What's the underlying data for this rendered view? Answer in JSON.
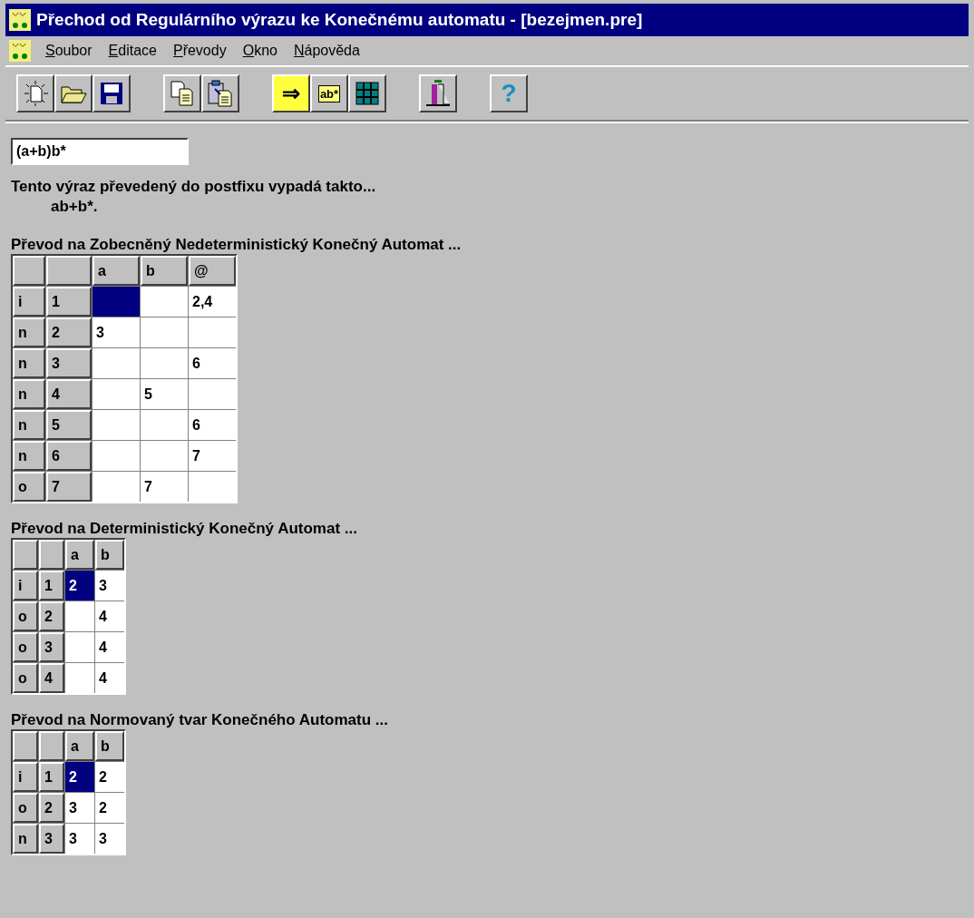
{
  "window": {
    "title": "Přechod od Regulárního výrazu ke Konečnému automatu - [bezejmen.pre]"
  },
  "menu": [
    "Soubor",
    "Editace",
    "Převody",
    "Okno",
    "Nápověda"
  ],
  "toolbar": [
    [
      {
        "kind": "new"
      },
      {
        "kind": "open"
      },
      {
        "kind": "save"
      }
    ],
    [
      {
        "kind": "copy"
      },
      {
        "kind": "paste"
      }
    ],
    [
      {
        "kind": "arrow",
        "label": "⇒",
        "selected": true
      },
      {
        "kind": "text",
        "label": "ab*",
        "selected": false
      },
      {
        "kind": "grid",
        "selected": false
      }
    ],
    [
      {
        "kind": "exit"
      }
    ],
    [
      {
        "kind": "help",
        "label": "?"
      }
    ]
  ],
  "expression": {
    "value": "(a+b)b*"
  },
  "postfix": {
    "caption": "Tento výraz převedený do postfixu vypadá takto...",
    "value": "ab+b*."
  },
  "tables": [
    {
      "title": "Převod na Zobecněný Nedeterministický Konečný Automat ...",
      "columns": [
        "a",
        "b",
        "@"
      ],
      "rows": [
        {
          "type": "i",
          "state": "1",
          "cells": [
            {
              "text": "",
              "selected": true
            },
            {
              "text": "",
              "selected": false
            },
            {
              "text": "2,4",
              "selected": false
            }
          ]
        },
        {
          "type": "n",
          "state": "2",
          "cells": [
            {
              "text": "3",
              "selected": false
            },
            {
              "text": "",
              "selected": false
            },
            {
              "text": "",
              "selected": false
            }
          ]
        },
        {
          "type": "n",
          "state": "3",
          "cells": [
            {
              "text": "",
              "selected": false
            },
            {
              "text": "",
              "selected": false
            },
            {
              "text": "6",
              "selected": false
            }
          ]
        },
        {
          "type": "n",
          "state": "4",
          "cells": [
            {
              "text": "",
              "selected": false
            },
            {
              "text": "5",
              "selected": false
            },
            {
              "text": "",
              "selected": false
            }
          ]
        },
        {
          "type": "n",
          "state": "5",
          "cells": [
            {
              "text": "",
              "selected": false
            },
            {
              "text": "",
              "selected": false
            },
            {
              "text": "6",
              "selected": false
            }
          ]
        },
        {
          "type": "n",
          "state": "6",
          "cells": [
            {
              "text": "",
              "selected": false
            },
            {
              "text": "",
              "selected": false
            },
            {
              "text": "7",
              "selected": false
            }
          ]
        },
        {
          "type": "o",
          "state": "7",
          "cells": [
            {
              "text": "",
              "selected": false
            },
            {
              "text": "7",
              "selected": false
            },
            {
              "text": "",
              "selected": false
            }
          ]
        }
      ]
    },
    {
      "title": "Převod na Deterministický Konečný Automat ...",
      "columns": [
        "a",
        "b"
      ],
      "rows": [
        {
          "type": "i",
          "state": "1",
          "cells": [
            {
              "text": "2",
              "selected": true
            },
            {
              "text": "3",
              "selected": false
            }
          ]
        },
        {
          "type": "o",
          "state": "2",
          "cells": [
            {
              "text": "",
              "selected": false
            },
            {
              "text": "4",
              "selected": false
            }
          ]
        },
        {
          "type": "o",
          "state": "3",
          "cells": [
            {
              "text": "",
              "selected": false
            },
            {
              "text": "4",
              "selected": false
            }
          ]
        },
        {
          "type": "o",
          "state": "4",
          "cells": [
            {
              "text": "",
              "selected": false
            },
            {
              "text": "4",
              "selected": false
            }
          ]
        }
      ]
    },
    {
      "title": "Převod na Normovaný tvar Konečného Automatu ...",
      "columns": [
        "a",
        "b"
      ],
      "rows": [
        {
          "type": "i",
          "state": "1",
          "cells": [
            {
              "text": "2",
              "selected": true
            },
            {
              "text": "2",
              "selected": false
            }
          ]
        },
        {
          "type": "o",
          "state": "2",
          "cells": [
            {
              "text": "3",
              "selected": false
            },
            {
              "text": "2",
              "selected": false
            }
          ]
        },
        {
          "type": "n",
          "state": "3",
          "cells": [
            {
              "text": "3",
              "selected": false
            },
            {
              "text": "3",
              "selected": false
            }
          ]
        }
      ]
    }
  ]
}
